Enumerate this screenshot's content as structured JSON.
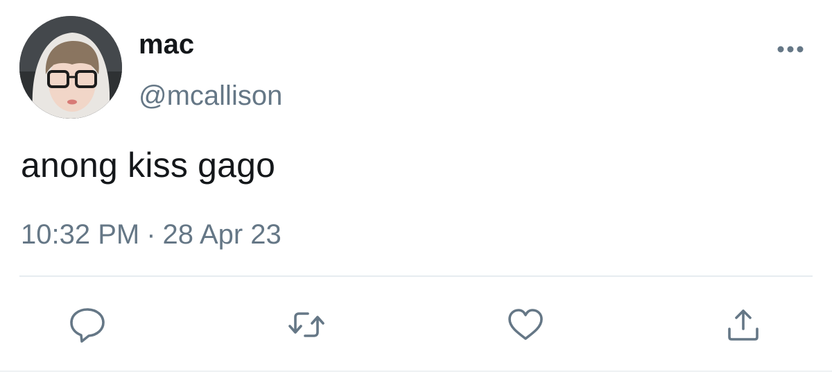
{
  "tweet": {
    "author": {
      "display_name": "mac",
      "handle": "@mcallison",
      "avatar_icon": "profile-photo"
    },
    "text": "anong kiss gago",
    "time": "10:32 PM",
    "separator": "·",
    "date": "28 Apr 23"
  },
  "actions": [
    {
      "name": "reply",
      "icon": "speech-bubble-icon"
    },
    {
      "name": "retweet",
      "icon": "retweet-arrows-icon"
    },
    {
      "name": "like",
      "icon": "heart-icon"
    },
    {
      "name": "share",
      "icon": "share-upload-icon"
    }
  ],
  "colors": {
    "text_primary": "#14171a",
    "text_secondary": "#657786",
    "divider": "#e6ecf0",
    "icon": "#657786"
  }
}
